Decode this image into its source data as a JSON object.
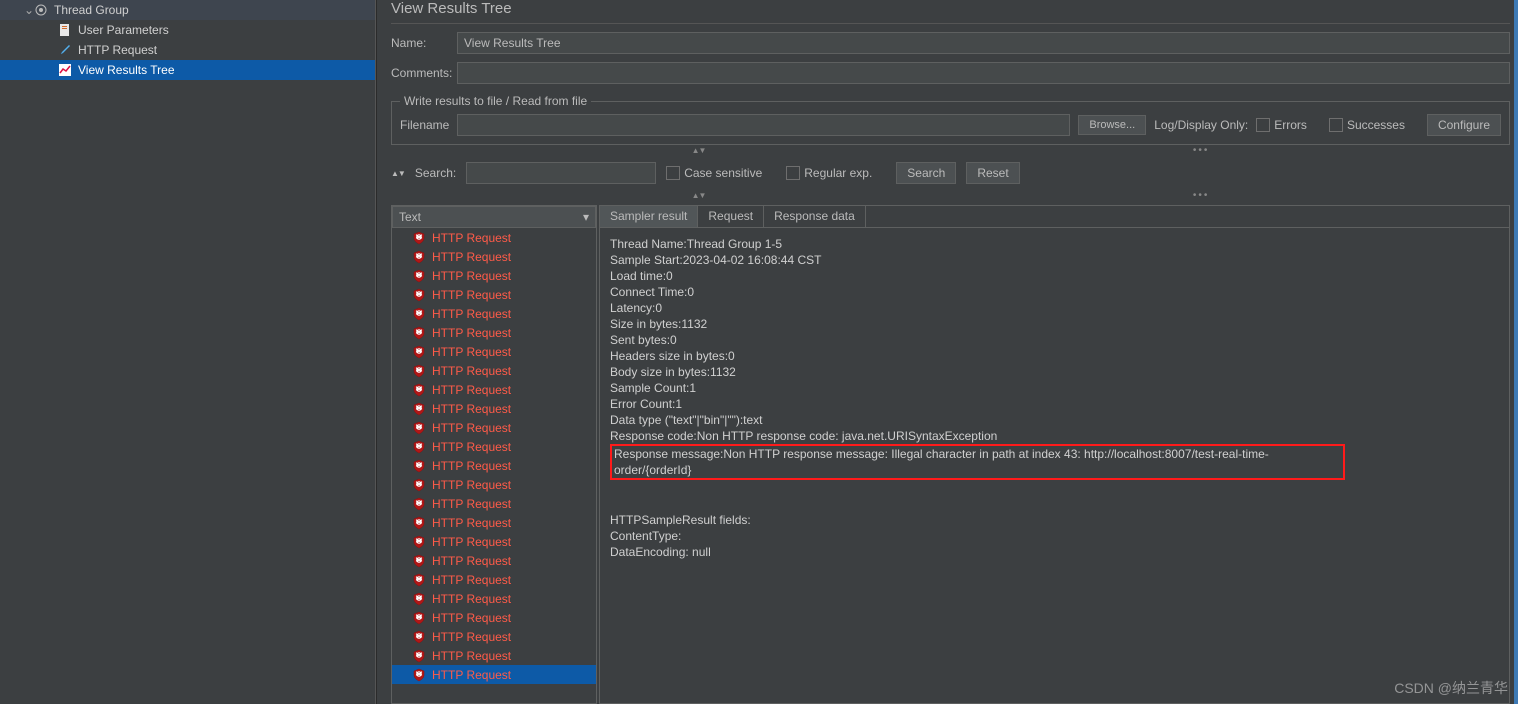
{
  "tree": {
    "root": {
      "label": "Thread Group"
    },
    "children": [
      {
        "label": "User Parameters"
      },
      {
        "label": "HTTP Request"
      },
      {
        "label": "View Results Tree",
        "selected": true
      }
    ]
  },
  "panel": {
    "title": "View Results Tree",
    "name_label": "Name:",
    "name_value": "View Results Tree",
    "comments_label": "Comments:",
    "comments_value": ""
  },
  "file_section": {
    "legend": "Write results to file / Read from file",
    "filename_label": "Filename",
    "browse": "Browse...",
    "log_label": "Log/Display Only:",
    "errors": "Errors",
    "successes": "Successes",
    "configure": "Configure"
  },
  "search": {
    "label": "Search:",
    "case_sensitive": "Case sensitive",
    "regexp": "Regular exp.",
    "search_btn": "Search",
    "reset_btn": "Reset"
  },
  "dropdown": {
    "value": "Text"
  },
  "tabs": {
    "sampler": "Sampler result",
    "request": "Request",
    "response": "Response data"
  },
  "result_item_label": "HTTP Request",
  "result_item_count": 24,
  "selected_result_index": 23,
  "sampler_lines": [
    "Thread Name:Thread Group 1-5",
    "Sample Start:2023-04-02 16:08:44 CST",
    "Load time:0",
    "Connect Time:0",
    "Latency:0",
    "Size in bytes:1132",
    "Sent bytes:0",
    "Headers size in bytes:0",
    "Body size in bytes:1132",
    "Sample Count:1",
    "Error Count:1",
    "Data type (\"text\"|\"bin\"|\"\"):text",
    "Response code:Non HTTP response code: java.net.URISyntaxException"
  ],
  "highlighted_line": "Response message:Non HTTP response message: Illegal character in path at index 43: http://localhost:8007/test-real-time-order/{orderId}",
  "sampler_footer": [
    "HTTPSampleResult fields:",
    "ContentType:",
    "DataEncoding: null"
  ],
  "watermark": "CSDN @纳兰青华"
}
